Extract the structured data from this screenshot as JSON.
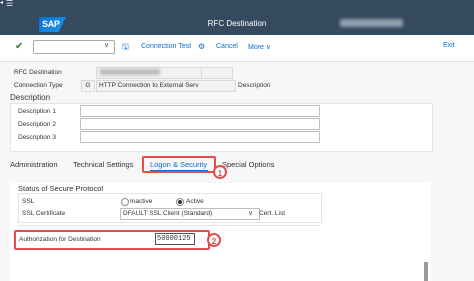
{
  "header": {
    "title": "RFC Destination",
    "logo_text": "SAP"
  },
  "toolbar": {
    "connection_test": "Connection Test",
    "cancel": "Cancel",
    "more": "More",
    "more_chevron": "∨",
    "exit": "Exit"
  },
  "form": {
    "rfc_destination_label": "RFC Destination",
    "connection_type_label": "Connection Type",
    "connection_type_code": "G",
    "connection_type_value": "HTTP Connection to External Serv",
    "description_inline_label": "Description",
    "description_heading": "Description",
    "description_1": "Description 1",
    "description_2": "Description 2",
    "description_3": "Description 3"
  },
  "tabs": {
    "administration": "Administration",
    "technical_settings": "Technical Settings",
    "logon_security": "Logon & Security",
    "special_options": "Special Options"
  },
  "section": {
    "title": "Status of Secure Protocol",
    "ssl_label": "SSL",
    "inactive": "Inactive",
    "active": "Active",
    "ssl_certificate_label": "SSL Certificate",
    "ssl_certificate_value": "DFAULT SSL Client (Standard)",
    "cert_list": "Cert. List",
    "authorization_label": "Authorization for Destination",
    "authorization_value": "50000125"
  },
  "annotations": {
    "badge_1": "1",
    "badge_2": "2"
  },
  "colors": {
    "shell_bar": "#354a5f",
    "accent": "#0a6ed1",
    "highlight": "#e54d4d"
  }
}
